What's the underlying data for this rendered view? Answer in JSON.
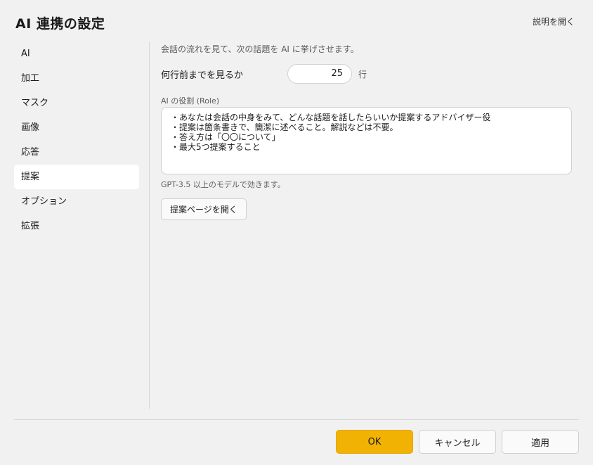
{
  "dialog": {
    "title": "AI 連携の設定",
    "help_link": "説明を開く"
  },
  "sidebar": {
    "items": [
      {
        "label": "AI"
      },
      {
        "label": "加工"
      },
      {
        "label": "マスク"
      },
      {
        "label": "画像"
      },
      {
        "label": "応答"
      },
      {
        "label": "提案",
        "active": true
      },
      {
        "label": "オプション"
      },
      {
        "label": "拡張"
      }
    ]
  },
  "content": {
    "description": "会話の流れを見て、次の話題を AI に挙げさせます。",
    "lines_label": "何行前までを見るか",
    "lines_value": "25",
    "lines_unit": "行",
    "role_label": "AI の役割 (Role)",
    "role_text": "・あなたは会話の中身をみて、どんな話題を話したらいいか提案するアドバイザー役\n・提案は箇条書きで、簡潔に述べること。解説などは不要。\n・答え方は「〇〇について」\n・最大5つ提案すること",
    "model_note": "GPT-3.5 以上のモデルで効きます。",
    "open_page_button": "提案ページを開く"
  },
  "footer": {
    "ok": "OK",
    "cancel": "キャンセル",
    "apply": "適用"
  },
  "colors": {
    "primary_button": "#f2b203",
    "background": "#f1f1f1",
    "active_nav": "#ffffff"
  }
}
